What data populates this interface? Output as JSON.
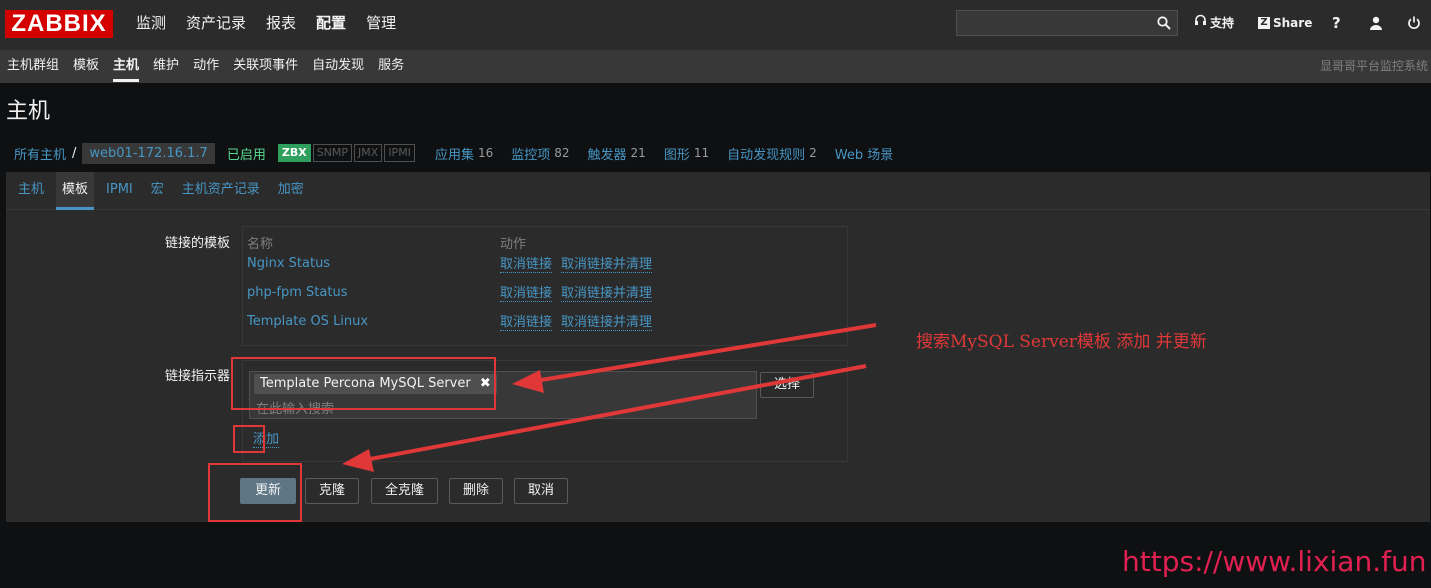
{
  "app": {
    "logo": "ZABBIX"
  },
  "main_menu": [
    {
      "label": "监测",
      "active": false
    },
    {
      "label": "资产记录",
      "active": false
    },
    {
      "label": "报表",
      "active": false
    },
    {
      "label": "配置",
      "active": true
    },
    {
      "label": "管理",
      "active": false
    }
  ],
  "top_links": {
    "support": "支持",
    "share": "Share",
    "help": "?"
  },
  "search": {
    "value": "",
    "icon": "search-icon"
  },
  "sub_menu": [
    {
      "label": "主机群组"
    },
    {
      "label": "模板"
    },
    {
      "label": "主机",
      "active": true
    },
    {
      "label": "维护"
    },
    {
      "label": "动作"
    },
    {
      "label": "关联项事件"
    },
    {
      "label": "自动发现"
    },
    {
      "label": "服务"
    }
  ],
  "system_name": "显哥哥平台监控系统",
  "page_title": "主机",
  "host_nav": {
    "all_hosts": "所有主机",
    "separator": "/",
    "current_host": "web01-172.16.1.7",
    "status": "已启用",
    "availability": [
      {
        "label": "ZBX",
        "on": true
      },
      {
        "label": "SNMP",
        "on": false
      },
      {
        "label": "JMX",
        "on": false
      },
      {
        "label": "IPMI",
        "on": false
      }
    ],
    "links": [
      {
        "label": "应用集",
        "count": "16"
      },
      {
        "label": "监控项",
        "count": "82"
      },
      {
        "label": "触发器",
        "count": "21"
      },
      {
        "label": "图形",
        "count": "11"
      },
      {
        "label": "自动发现规则",
        "count": "2"
      },
      {
        "label": "Web 场景",
        "count": ""
      }
    ]
  },
  "tabs": [
    {
      "label": "主机"
    },
    {
      "label": "模板",
      "active": true
    },
    {
      "label": "IPMI"
    },
    {
      "label": "宏"
    },
    {
      "label": "主机资产记录"
    },
    {
      "label": "加密"
    }
  ],
  "linked_templates": {
    "label": "链接的模板",
    "col_name": "名称",
    "col_action": "动作",
    "rows": [
      {
        "name": "Nginx Status",
        "unlink": "取消链接",
        "unlink_clear": "取消链接并清理"
      },
      {
        "name": "php-fpm Status",
        "unlink": "取消链接",
        "unlink_clear": "取消链接并清理"
      },
      {
        "name": "Template OS Linux",
        "unlink": "取消链接",
        "unlink_clear": "取消链接并清理"
      }
    ]
  },
  "link_new": {
    "label": "链接指示器",
    "chip": "Template Percona MySQL Server",
    "placeholder": "在此输入搜索",
    "select_button": "选择",
    "add_link": "添加"
  },
  "buttons": {
    "update": "更新",
    "clone": "克隆",
    "full_clone": "全克隆",
    "delete": "删除",
    "cancel": "取消"
  },
  "annotation": "搜索MySQL Server模板 添加  并更新",
  "watermark": "https://www.lixian.fun",
  "colors": {
    "link": "#4796c4",
    "annotation": "#e03838",
    "enabled": "#59db8f",
    "logo": "#d40000"
  }
}
